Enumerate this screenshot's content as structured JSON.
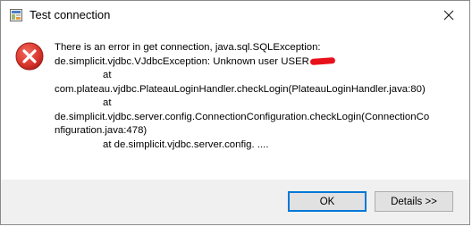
{
  "window": {
    "title": "Test connection",
    "app_icon": "database-connection-icon",
    "close_icon": "close-icon"
  },
  "message": {
    "icon": "error-icon",
    "line1": "There is an error in get connection, java.sql.SQLException:",
    "line2": "de.simplicit.vjdbc.VJdbcException: Unknown user USER",
    "line3": "at",
    "line4": "com.plateau.vjdbc.PlateauLoginHandler.checkLogin(PlateauLoginHandler.java:80)",
    "line5": "at",
    "line6": "de.simplicit.vjdbc.server.config.ConnectionConfiguration.checkLogin(ConnectionCo",
    "line7": "nfiguration.java:478)",
    "line8": "at de.simplicit.vjdbc.server.config. ....",
    "redaction_color": "#e8111b"
  },
  "buttons": {
    "ok_label": "OK",
    "details_label": "Details >>"
  },
  "colors": {
    "error_red": "#d9342b",
    "focus_blue": "#0078d7",
    "footer_bg": "#f0f0f0"
  }
}
